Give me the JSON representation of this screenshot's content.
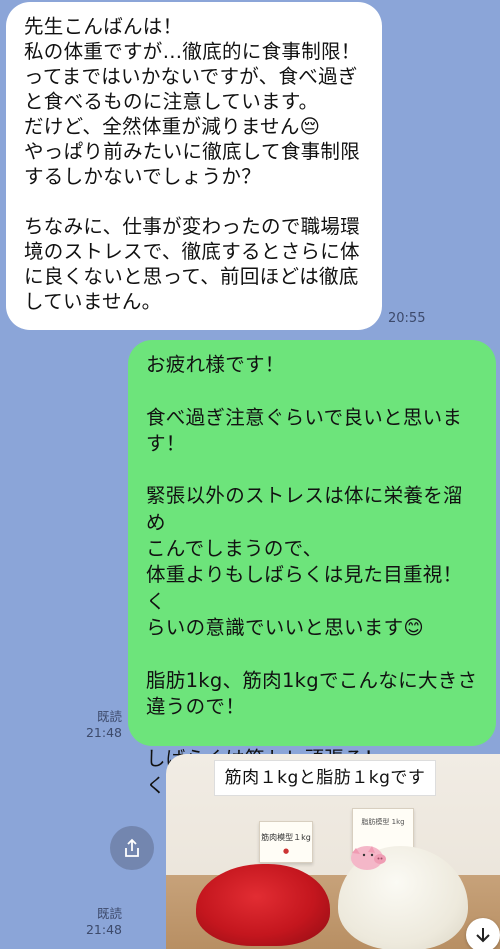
{
  "messages": {
    "incoming": {
      "text": "先生こんばんは！\n私の体重ですが…徹底的に食事制限！\nってまではいかないですが、食べ過ぎ\nと食べるものに注意しています。\nだけど、全然体重が減りません😔\nやっぱり前みたいに徹底して食事制限\nするしかないでしょうか？\n\nちなみに、仕事が変わったので職場環\n境のストレスで、徹底するとさらに体\nに良くないと思って、前回ほどは徹底\nしていません。",
      "time": "20:55"
    },
    "outgoing": {
      "text": "お疲れ様です！\n\n食べ過ぎ注意ぐらいで良いと思いま\nす！\n\n緊張以外のストレスは体に栄養を溜め\nこんでしまうので、\n体重よりもしばらくは見た目重視！く\nらいの意識でいいと思います😊\n\n脂肪1kg、筋肉1kgでこんなに大きさ\n違うので！\n\nしばらくは筋トレ頑張ろ！\nくらいの気持ちで笑",
      "read_label": "既読",
      "time": "21:48"
    },
    "photo": {
      "title": "筋肉１kgと脂肪１kgです",
      "card_muscle": "筋肉模型１kg",
      "card_fat": "脂肪模型 1kg",
      "read_label": "既読",
      "time": "21:48"
    }
  },
  "icons": {
    "share": "share-icon",
    "scroll": "arrow-down-icon"
  },
  "colors": {
    "background": "#8ba5d8",
    "incoming_bubble": "#ffffff",
    "outgoing_bubble": "#6de47b"
  }
}
